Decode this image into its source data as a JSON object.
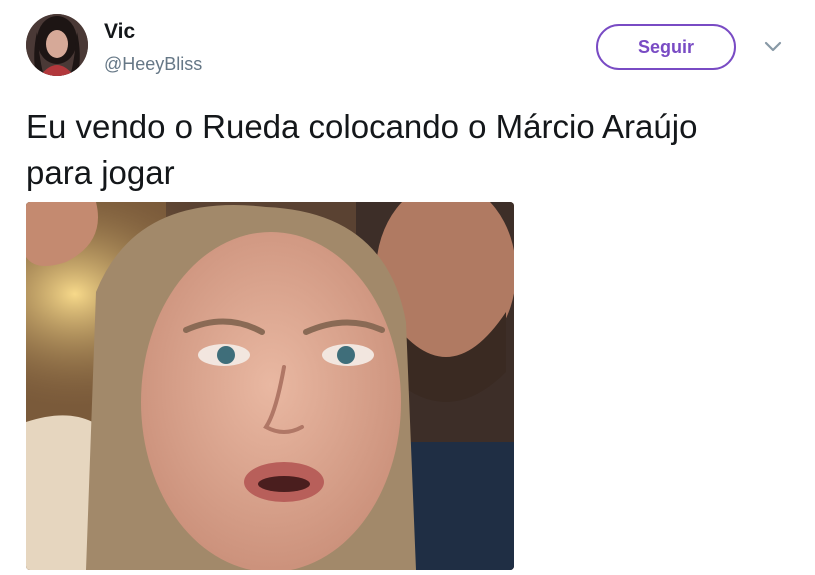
{
  "user": {
    "display_name": "Vic",
    "handle": "@HeeyBliss",
    "avatar_icon": "profile-photo"
  },
  "actions": {
    "follow_label": "Seguir",
    "more_icon": "chevron-down-icon"
  },
  "tweet": {
    "text": "Eu vendo o Rueda colocando o Márcio Araújo\npara jogar"
  },
  "media": {
    "icon": "photo-crying-woman"
  },
  "colors": {
    "accent": "#794bc4",
    "text": "#14171a",
    "secondary": "#657786",
    "background": "#ffffff"
  }
}
